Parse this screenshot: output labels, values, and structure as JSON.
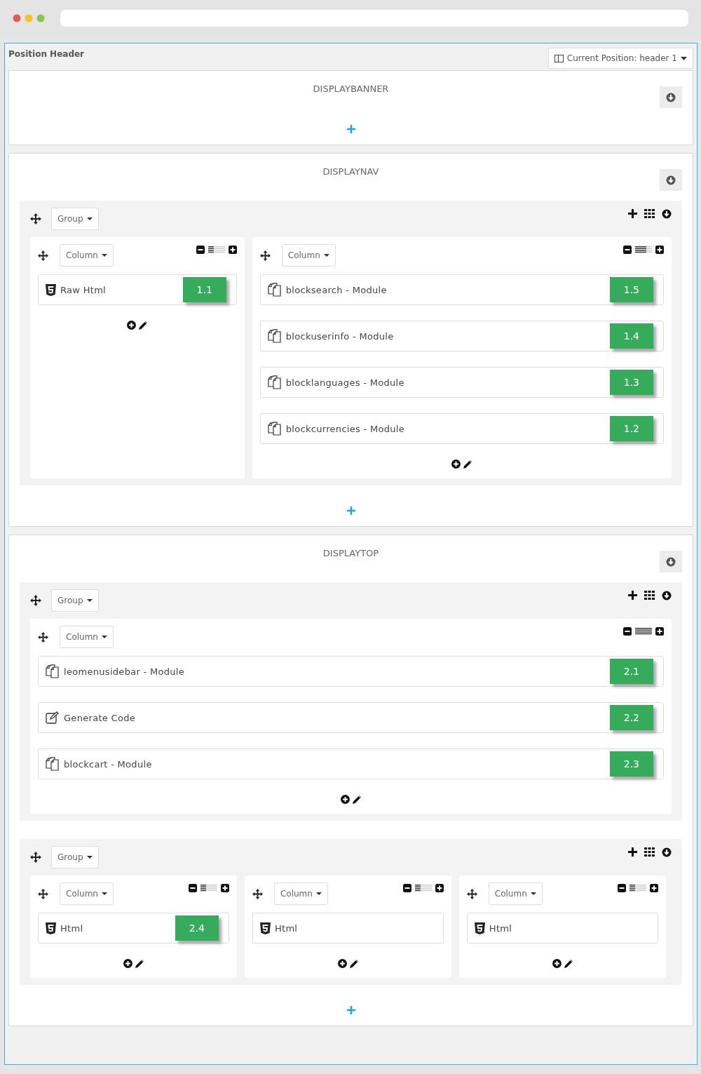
{
  "title": "Position Header",
  "position_select": {
    "label": "Current Position: header 1"
  },
  "sections": [
    {
      "title": "DISPLAYBANNER"
    },
    {
      "title": "DISPLAYNAV",
      "groups": [
        {
          "label": "Group",
          "columns": [
            {
              "label": "Column",
              "level": 0.33,
              "widgets": [
                {
                  "kind": "html",
                  "label": "Raw Html",
                  "badge": "1.1"
                }
              ]
            },
            {
              "label": "Column",
              "level": 0.67,
              "widgets": [
                {
                  "kind": "module",
                  "label": "blocksearch - Module",
                  "badge": "1.5"
                },
                {
                  "kind": "module",
                  "label": "blockuserinfo - Module",
                  "badge": "1.4"
                },
                {
                  "kind": "module",
                  "label": "blocklanguages - Module",
                  "badge": "1.3"
                },
                {
                  "kind": "module",
                  "label": "blockcurrencies - Module",
                  "badge": "1.2"
                }
              ]
            }
          ]
        }
      ]
    },
    {
      "title": "DISPLAYTOP",
      "groups": [
        {
          "label": "Group",
          "columns": [
            {
              "label": "Column",
              "level": 1,
              "widgets": [
                {
                  "kind": "module",
                  "label": "leomenusidebar - Module",
                  "badge": "2.1"
                },
                {
                  "kind": "code",
                  "label": "Generate Code",
                  "badge": "2.2"
                },
                {
                  "kind": "module",
                  "label": "blockcart - Module",
                  "badge": "2.3"
                }
              ]
            }
          ]
        },
        {
          "label": "Group",
          "columns": [
            {
              "label": "Column",
              "level": 0.33,
              "widgets": [
                {
                  "kind": "html",
                  "label": "Html",
                  "badge": "2.4"
                }
              ]
            },
            {
              "label": "Column",
              "level": 0.33,
              "widgets": [
                {
                  "kind": "html",
                  "label": "Html"
                }
              ]
            },
            {
              "label": "Column",
              "level": 0.33,
              "widgets": [
                {
                  "kind": "html",
                  "label": "Html"
                }
              ]
            }
          ]
        }
      ]
    }
  ]
}
